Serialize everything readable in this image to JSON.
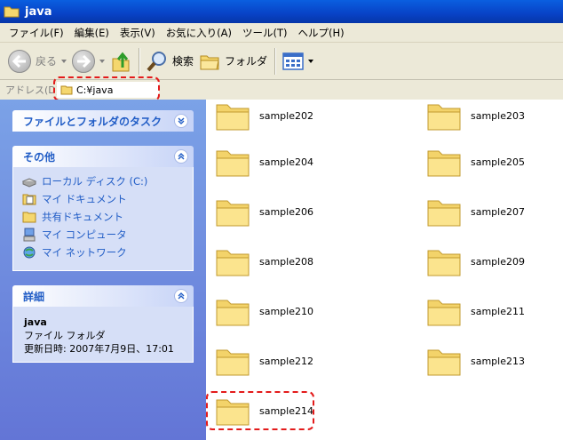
{
  "window": {
    "title": "java"
  },
  "menu": [
    "ファイル(F)",
    "編集(E)",
    "表示(V)",
    "お気に入り(A)",
    "ツール(T)",
    "ヘルプ(H)"
  ],
  "toolbar": {
    "back_label": "戻る",
    "search_label": "検索",
    "folders_label": "フォルダ"
  },
  "address": {
    "label": "アドレス(D)",
    "value": "C:¥java"
  },
  "left": {
    "tasks_title": "ファイルとフォルダのタスク",
    "other_title": "その他",
    "other_items": [
      "ローカル ディスク (C:)",
      "マイ ドキュメント",
      "共有ドキュメント",
      "マイ コンピュータ",
      "マイ ネットワーク"
    ],
    "details_title": "詳細",
    "details_name": "java",
    "details_type": "ファイル フォルダ",
    "details_modified": "更新日時: 2007年7月9日、17:01"
  },
  "folders": [
    "sample202",
    "sample203",
    "sample204",
    "sample205",
    "sample206",
    "sample207",
    "sample208",
    "sample209",
    "sample210",
    "sample211",
    "sample212",
    "sample213",
    "sample214"
  ],
  "colors": {
    "title_bar": "#0842c6",
    "left_pane": "#6375d6",
    "task_title": "#215dc6",
    "highlight": "#e31b1b"
  }
}
